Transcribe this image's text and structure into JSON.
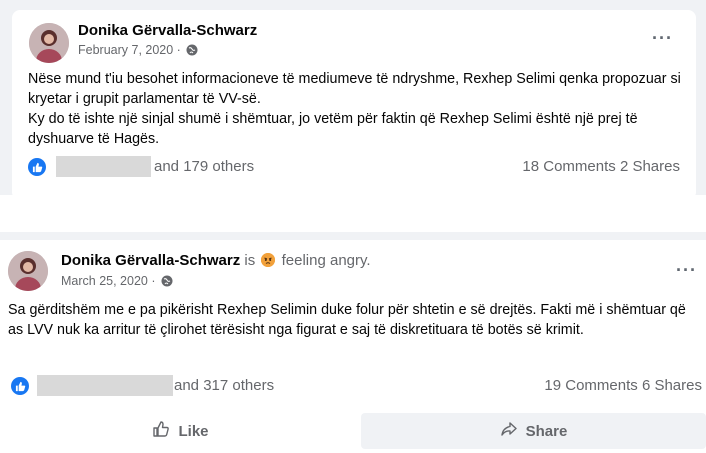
{
  "post1": {
    "author": "Donika Gërvalla-Schwarz",
    "date": "February 7, 2020 ·",
    "more": "···",
    "paragraphs": [
      "Nëse mund t'iu besohet informacioneve të mediumeve të ndryshme, Rexhep Selimi qenka propozuar si kryetar i grupit parlamentar të VV-së.",
      "Ky do të ishte një sinjal shumë i shëmtuar, jo vetëm për faktin që Rexhep Selimi është një prej të dyshuarve të Hagës."
    ],
    "reactions_others": "and 179 others",
    "comments": "18 Comments",
    "shares": "2 Shares"
  },
  "post2": {
    "author": "Donika Gërvalla-Schwarz",
    "is": "is",
    "feeling": "feeling angry.",
    "date": "March 25, 2020 ·",
    "more": "···",
    "paragraph": "Sa gërditshëm me e pa pikërisht Rexhep Selimin duke folur për shtetin e së drejtës. Fakti më i shëmtuar që as LVV nuk ka arritur të çlirohet tërësisht nga figurat e saj të diskretituara të botës së krimit.",
    "reactions_others": "and 317 others",
    "comments": "19 Comments",
    "shares": "6 Shares"
  },
  "actions": {
    "like_label": "Like",
    "share_label": "Share"
  },
  "icons": {
    "like": "thumbs-up-icon",
    "globe": "globe-icon",
    "angry": "angry-emoji-icon",
    "share": "share-arrow-icon"
  },
  "colors": {
    "facebook_blue": "#1877f2",
    "meta_gray": "#65676b",
    "background": "#f0f2f5"
  }
}
